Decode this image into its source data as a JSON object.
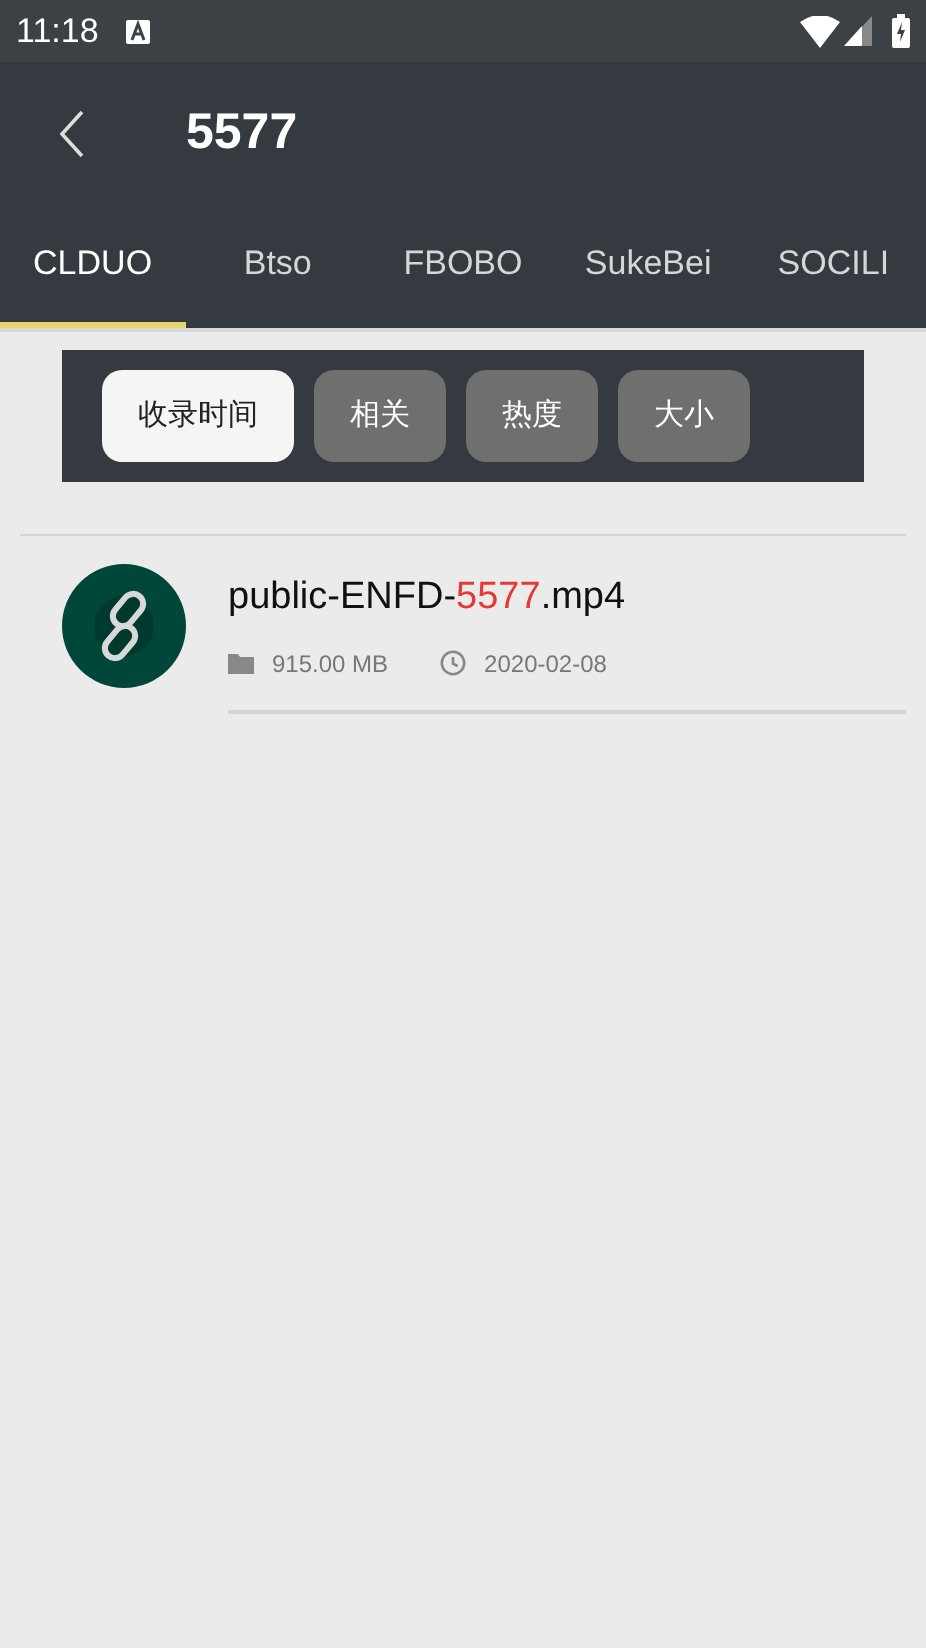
{
  "status_bar": {
    "time": "11:18"
  },
  "app_bar": {
    "title": "5577"
  },
  "tabs": [
    {
      "label": "CLDUO",
      "selected": true
    },
    {
      "label": "Btso",
      "selected": false
    },
    {
      "label": "FBOBO",
      "selected": false
    },
    {
      "label": "SukeBei",
      "selected": false
    },
    {
      "label": "SOCILI",
      "selected": false
    }
  ],
  "sort_options": [
    {
      "label": "收录时间",
      "selected": true
    },
    {
      "label": "相关",
      "selected": false
    },
    {
      "label": "热度",
      "selected": false
    },
    {
      "label": "大小",
      "selected": false
    }
  ],
  "results": [
    {
      "title": "public-ENFD-**5577**.mp4",
      "size": "915.00 MB",
      "date": "2020-02-08"
    }
  ]
}
